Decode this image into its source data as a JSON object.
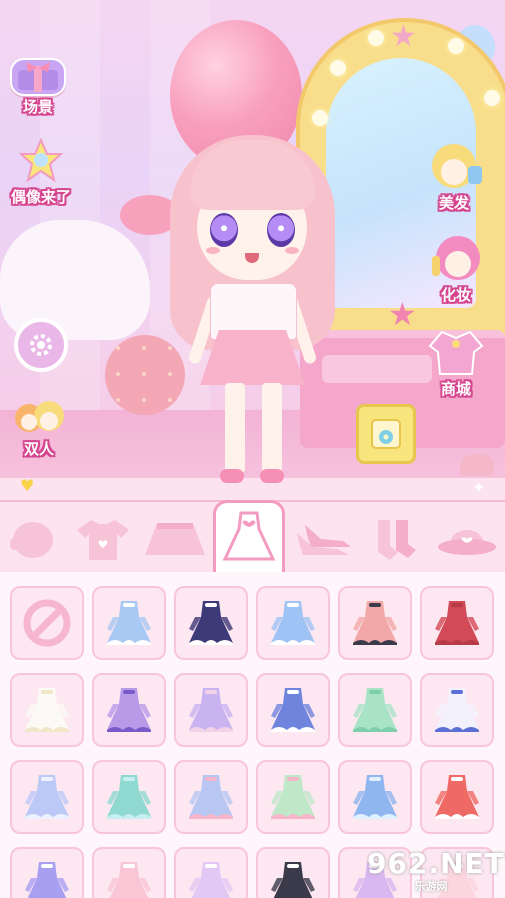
{
  "left_menu": {
    "scene_label": "场景",
    "idol_label": "偶像来了",
    "duo_label": "双人"
  },
  "right_menu": {
    "hair_label": "美发",
    "makeup_label": "化妆",
    "shop_label": "商城"
  },
  "tabs": [
    {
      "name": "face",
      "icon": "face-icon"
    },
    {
      "name": "top",
      "icon": "shirt-icon"
    },
    {
      "name": "skirt",
      "icon": "skirt-icon"
    },
    {
      "name": "dress",
      "icon": "dress-icon",
      "active": true
    },
    {
      "name": "shoes",
      "icon": "heels-icon"
    },
    {
      "name": "socks",
      "icon": "socks-icon"
    },
    {
      "name": "hat",
      "icon": "hat-icon"
    }
  ],
  "items": [
    {
      "kind": "none",
      "icon": "no-sign-icon"
    },
    {
      "kind": "dress",
      "color": "#a8c9f3",
      "accent": "#ffffff"
    },
    {
      "kind": "dress",
      "color": "#3d3a78",
      "accent": "#ffffff"
    },
    {
      "kind": "dress",
      "color": "#9fc3f5",
      "accent": "#ffffff"
    },
    {
      "kind": "dress",
      "color": "#f2a8a6",
      "accent": "#3a3a4a"
    },
    {
      "kind": "dress",
      "color": "#d24a58",
      "accent": "#b73a47"
    },
    {
      "kind": "dress",
      "color": "#fbfaf6",
      "accent": "#f1e6c8"
    },
    {
      "kind": "dress",
      "color": "#b79ae8",
      "accent": "#7a5ac9"
    },
    {
      "kind": "dress",
      "color": "#c9b3f1",
      "accent": "#f2d2e6"
    },
    {
      "kind": "dress",
      "color": "#6f84dd",
      "accent": "#ffffff"
    },
    {
      "kind": "dress",
      "color": "#a8e3c6",
      "accent": "#7dcfaa"
    },
    {
      "kind": "dress",
      "color": "#f4f1ff",
      "accent": "#5b6fd4"
    },
    {
      "kind": "dress",
      "color": "#bcc9f7",
      "accent": "#eef1ff"
    },
    {
      "kind": "dress",
      "color": "#8fd9d1",
      "accent": "#c7eef0"
    },
    {
      "kind": "dress",
      "color": "#b7c7f2",
      "accent": "#f7b5c9"
    },
    {
      "kind": "dress",
      "color": "#bfe8c8",
      "accent": "#f7b5c9"
    },
    {
      "kind": "dress",
      "color": "#8fb6ef",
      "accent": "#dff0ff"
    },
    {
      "kind": "dress",
      "color": "#ef6a64",
      "accent": "#ffffff"
    },
    {
      "kind": "dress",
      "color": "#a99ff1",
      "accent": "#ffffff"
    },
    {
      "kind": "dress",
      "color": "#f9c6d6",
      "accent": "#ffffff"
    },
    {
      "kind": "dress",
      "color": "#e2c8f4",
      "accent": "#ffffff"
    },
    {
      "kind": "dress",
      "color": "#3a3a4a",
      "accent": "#ffffff"
    },
    {
      "kind": "dress",
      "color": "#d9b7f0",
      "accent": "#ffffff"
    },
    {
      "kind": "dress",
      "color": "#fbd6df",
      "accent": "#ffffff"
    }
  ],
  "watermark": {
    "logo": "962.NET",
    "sub": "乐游网"
  },
  "colors": {
    "accent_pink": "#f39bc0",
    "label_outline": "#d5468f",
    "save_yellow": "#f8e57d"
  }
}
